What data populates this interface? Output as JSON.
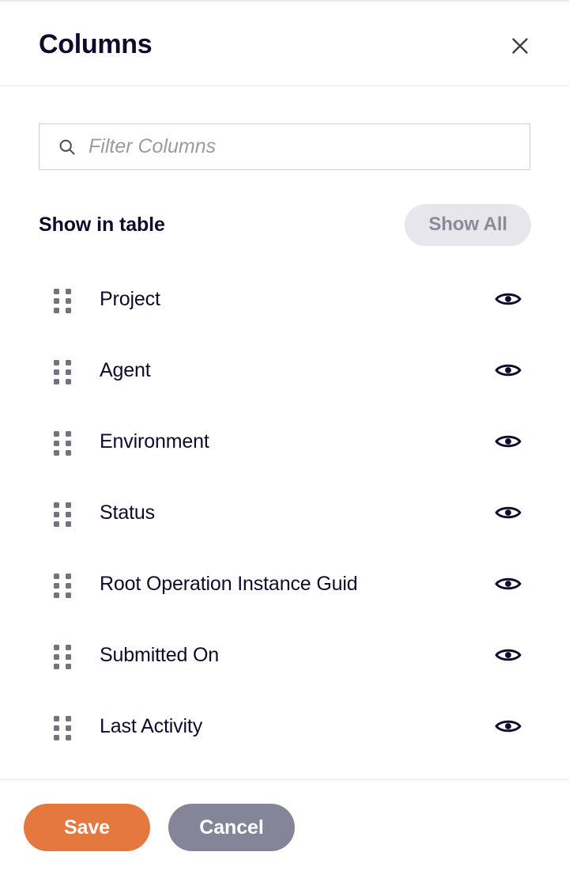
{
  "dialog": {
    "title": "Columns",
    "close_icon": "close-icon"
  },
  "search": {
    "icon": "search-icon",
    "placeholder": "Filter Columns",
    "value": ""
  },
  "section": {
    "title": "Show in table",
    "show_all_label": "Show All"
  },
  "columns": [
    {
      "label": "Project",
      "visible": true,
      "icon": "eye-icon",
      "handle": "drag-handle-icon"
    },
    {
      "label": "Agent",
      "visible": true,
      "icon": "eye-icon",
      "handle": "drag-handle-icon"
    },
    {
      "label": "Environment",
      "visible": true,
      "icon": "eye-icon",
      "handle": "drag-handle-icon"
    },
    {
      "label": "Status",
      "visible": true,
      "icon": "eye-icon",
      "handle": "drag-handle-icon"
    },
    {
      "label": "Root Operation Instance Guid",
      "visible": true,
      "icon": "eye-icon",
      "handle": "drag-handle-icon"
    },
    {
      "label": "Submitted On",
      "visible": true,
      "icon": "eye-icon",
      "handle": "drag-handle-icon"
    },
    {
      "label": "Last Activity",
      "visible": true,
      "icon": "eye-icon",
      "handle": "drag-handle-icon"
    }
  ],
  "footer": {
    "save_label": "Save",
    "cancel_label": "Cancel"
  },
  "colors": {
    "title_text": "#0d0d2b",
    "save_button": "#e4783f",
    "cancel_button": "#85859a",
    "show_all_bg": "#e6e6ec",
    "show_all_text": "#8a8a99",
    "placeholder_text": "#9a9aa3",
    "drag_handle": "#73737f",
    "eye_icon": "#0d0d2b",
    "border": "#e6e6ec"
  }
}
